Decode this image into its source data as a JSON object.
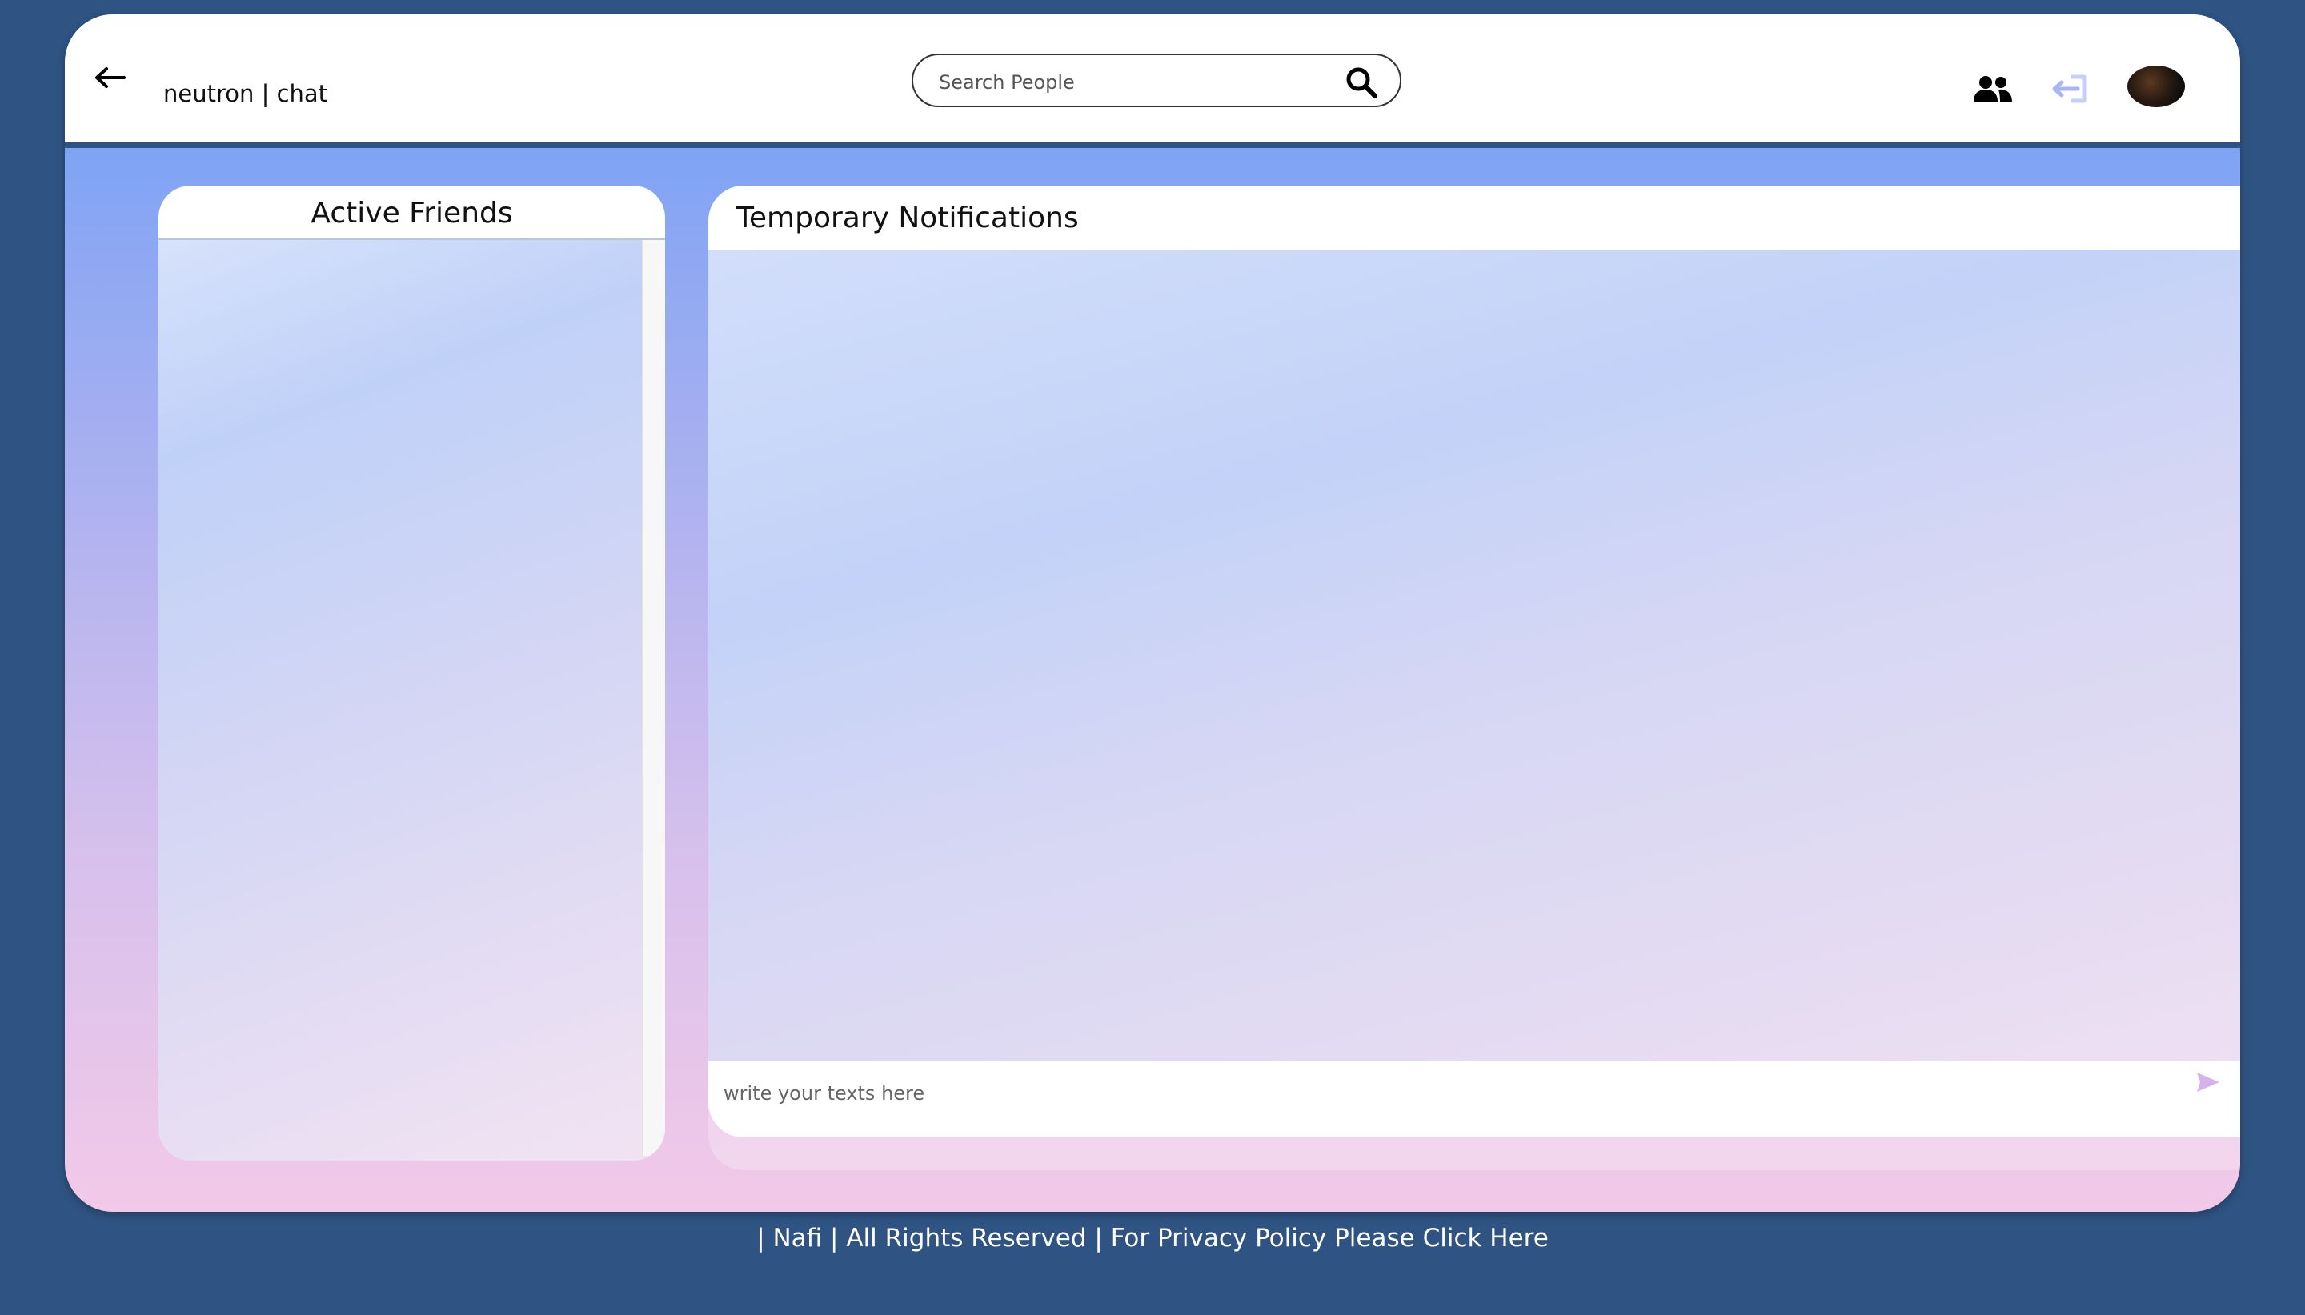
{
  "header": {
    "brand": "neutron | chat",
    "search_placeholder": "Search People",
    "icons": {
      "back": "arrow-left-icon",
      "search": "magnifier-icon",
      "friends": "users-icon",
      "logout": "logout-icon",
      "avatar": "user-avatar"
    }
  },
  "friends_panel": {
    "title": "Active Friends"
  },
  "notifications_panel": {
    "title": "Temporary Notifications",
    "composer_placeholder": "write your texts here"
  },
  "footer": {
    "text": "| Nafi | All Rights Reserved | For Privacy Policy Please Click Here"
  },
  "colors": {
    "page_background": "#2f5382",
    "gradient_top": "#6c9cf5",
    "gradient_bottom": "#f2c9e8",
    "panel_header": "#ffffff",
    "send_icon": "#d6b2ec"
  }
}
